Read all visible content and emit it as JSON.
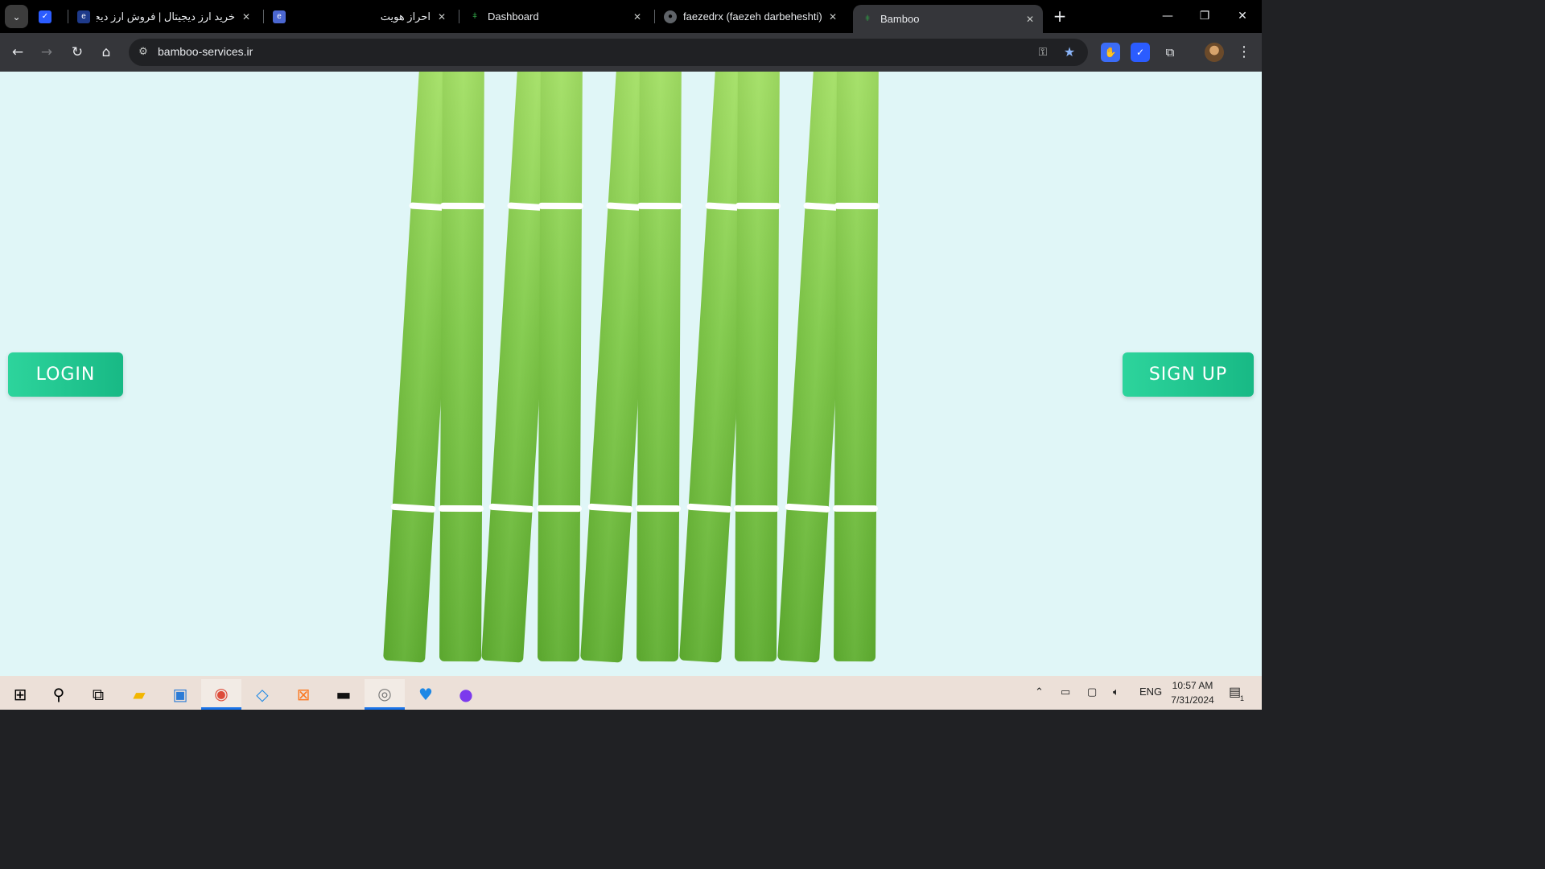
{
  "browser": {
    "tabs": [
      {
        "title": "",
        "icon": "task-check-icon",
        "kind": "pinned"
      },
      {
        "title": "خرید ارز دیجیتال | فروش ارز دیجیتال",
        "icon": "exchange-icon",
        "rtl": true
      },
      {
        "title": "احراز هویت",
        "icon": "exchange-icon",
        "rtl": true
      },
      {
        "title": "Dashboard",
        "icon": "bamboo-icon"
      },
      {
        "title": "faezedrx (faezeh darbeheshti)",
        "icon": "github-icon"
      },
      {
        "title": "Bamboo",
        "icon": "bamboo-icon",
        "active": true
      }
    ],
    "new_tab": "+",
    "window_controls": {
      "minimize": "—",
      "restore": "❐",
      "close": "✕"
    },
    "address": "bamboo-services.ir"
  },
  "page": {
    "login_label": "LOGIN",
    "signup_label": "SIGN UP",
    "colors": {
      "background": "#e0f6f7",
      "bamboo_top": "#a3e064",
      "bamboo_bottom": "#5faf30",
      "button": "#1fc590"
    }
  },
  "taskbar": {
    "apps": [
      "windows-start-icon",
      "search-icon",
      "task-view-icon",
      "file-explorer-icon",
      "control-panel-icon",
      "chrome-icon",
      "vscode-icon",
      "xampp-icon",
      "terminal-icon",
      "app-icon",
      "health-icon",
      "github-desktop-icon"
    ],
    "language": "ENG",
    "time": "10:57 AM",
    "date": "7/31/2024",
    "notification_count": "1"
  }
}
